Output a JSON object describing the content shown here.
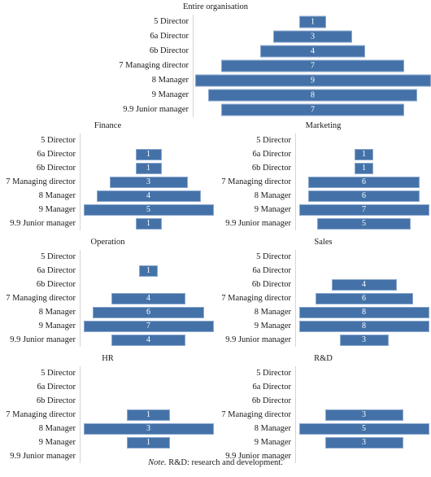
{
  "note": {
    "lead": "Note.",
    "text": " R&D: research and development."
  },
  "colors": {
    "bar_fill": "#4472a8",
    "bar_stroke": "#8ca9cf",
    "axis_line": "#d4d4d4",
    "text": "#1a1a1a",
    "bar_label": "#ffffff"
  },
  "row_labels": [
    "5 Director",
    "6a Director",
    "6b Director",
    "7 Managing director",
    "8 Manager",
    "9 Manager",
    "9.9 Junior manager"
  ],
  "chart_data": {
    "type": "bar",
    "orientation": "horizontal-centered",
    "description": "Small-multiple centered (pyramid / funnel) bar charts of headcount by hierarchy level for the entire organisation and each department.",
    "categories": [
      "5 Director",
      "6a Director",
      "6b Director",
      "7 Managing director",
      "8 Manager",
      "9 Manager",
      "9.9 Junior manager"
    ],
    "xlabel": "",
    "ylabel": "",
    "grid": false,
    "legend": false,
    "value_labels": true,
    "panels": [
      {
        "id": "entire",
        "title": "Entire organisation",
        "values": [
          1,
          3,
          4,
          7,
          9,
          8,
          7
        ],
        "max": 9,
        "xlim": [
          0,
          9
        ]
      },
      {
        "id": "finance",
        "title": "Finance",
        "values": [
          0,
          1,
          1,
          3,
          4,
          5,
          1
        ],
        "max": 5,
        "xlim": [
          0,
          5
        ]
      },
      {
        "id": "marketing",
        "title": "Marketing",
        "values": [
          0,
          1,
          1,
          6,
          6,
          7,
          5
        ],
        "max": 7,
        "xlim": [
          0,
          7
        ]
      },
      {
        "id": "operation",
        "title": "Operation",
        "values": [
          0,
          1,
          0,
          4,
          6,
          7,
          4
        ],
        "max": 7,
        "xlim": [
          0,
          7
        ]
      },
      {
        "id": "sales",
        "title": "Sales",
        "values": [
          0,
          0,
          4,
          6,
          8,
          8,
          3
        ],
        "max": 8,
        "xlim": [
          0,
          8
        ]
      },
      {
        "id": "hr",
        "title": "HR",
        "values": [
          0,
          0,
          0,
          1,
          3,
          1,
          0
        ],
        "max": 3,
        "xlim": [
          0,
          3
        ]
      },
      {
        "id": "rnd",
        "title": "R&D",
        "values": [
          0,
          0,
          0,
          3,
          5,
          3,
          0
        ],
        "max": 5,
        "xlim": [
          0,
          5
        ]
      }
    ]
  }
}
